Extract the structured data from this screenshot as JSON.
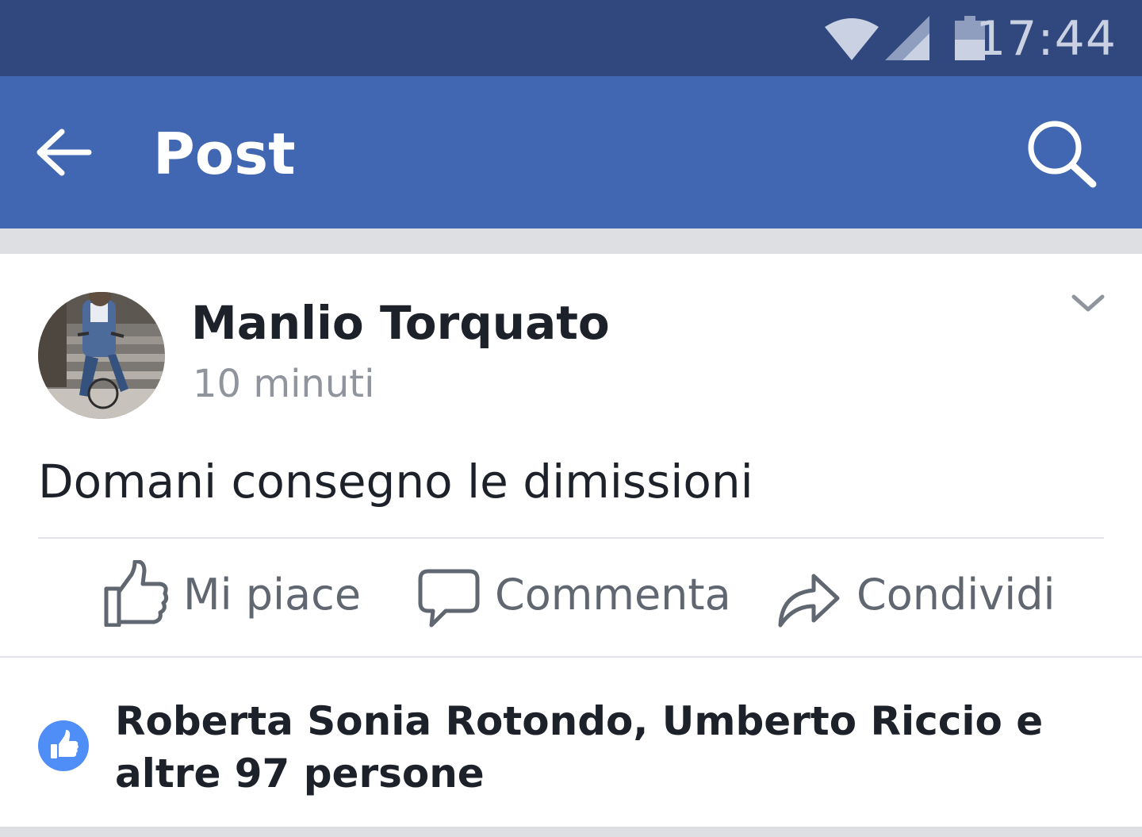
{
  "status_bar": {
    "time": "17:44",
    "icons": [
      "wifi-icon",
      "signal-icon",
      "battery-icon"
    ]
  },
  "app_bar": {
    "title": "Post",
    "back_icon": "back-arrow-icon",
    "search_icon": "search-icon"
  },
  "post": {
    "author": "Manlio Torquato",
    "time_ago": "10 minuti",
    "text": "Domani consegno le dimissioni",
    "menu_icon": "chevron-down-icon",
    "actions": [
      {
        "label": "Mi piace",
        "icon": "thumbs-up-icon"
      },
      {
        "label": "Commenta",
        "icon": "comment-icon"
      },
      {
        "label": "Condividi",
        "icon": "share-icon"
      }
    ],
    "reactions_summary": "Roberta Sonia Rotondo, Umberto Riccio e altre 97 persone"
  },
  "colors": {
    "status_bar_bg": "#30487d",
    "app_bar_bg": "#4267b2",
    "like_blue": "#4f8ef7",
    "text_primary": "#1d2129",
    "text_secondary": "#90949c",
    "action_gray": "#606770",
    "separator": "#dddfe2"
  }
}
